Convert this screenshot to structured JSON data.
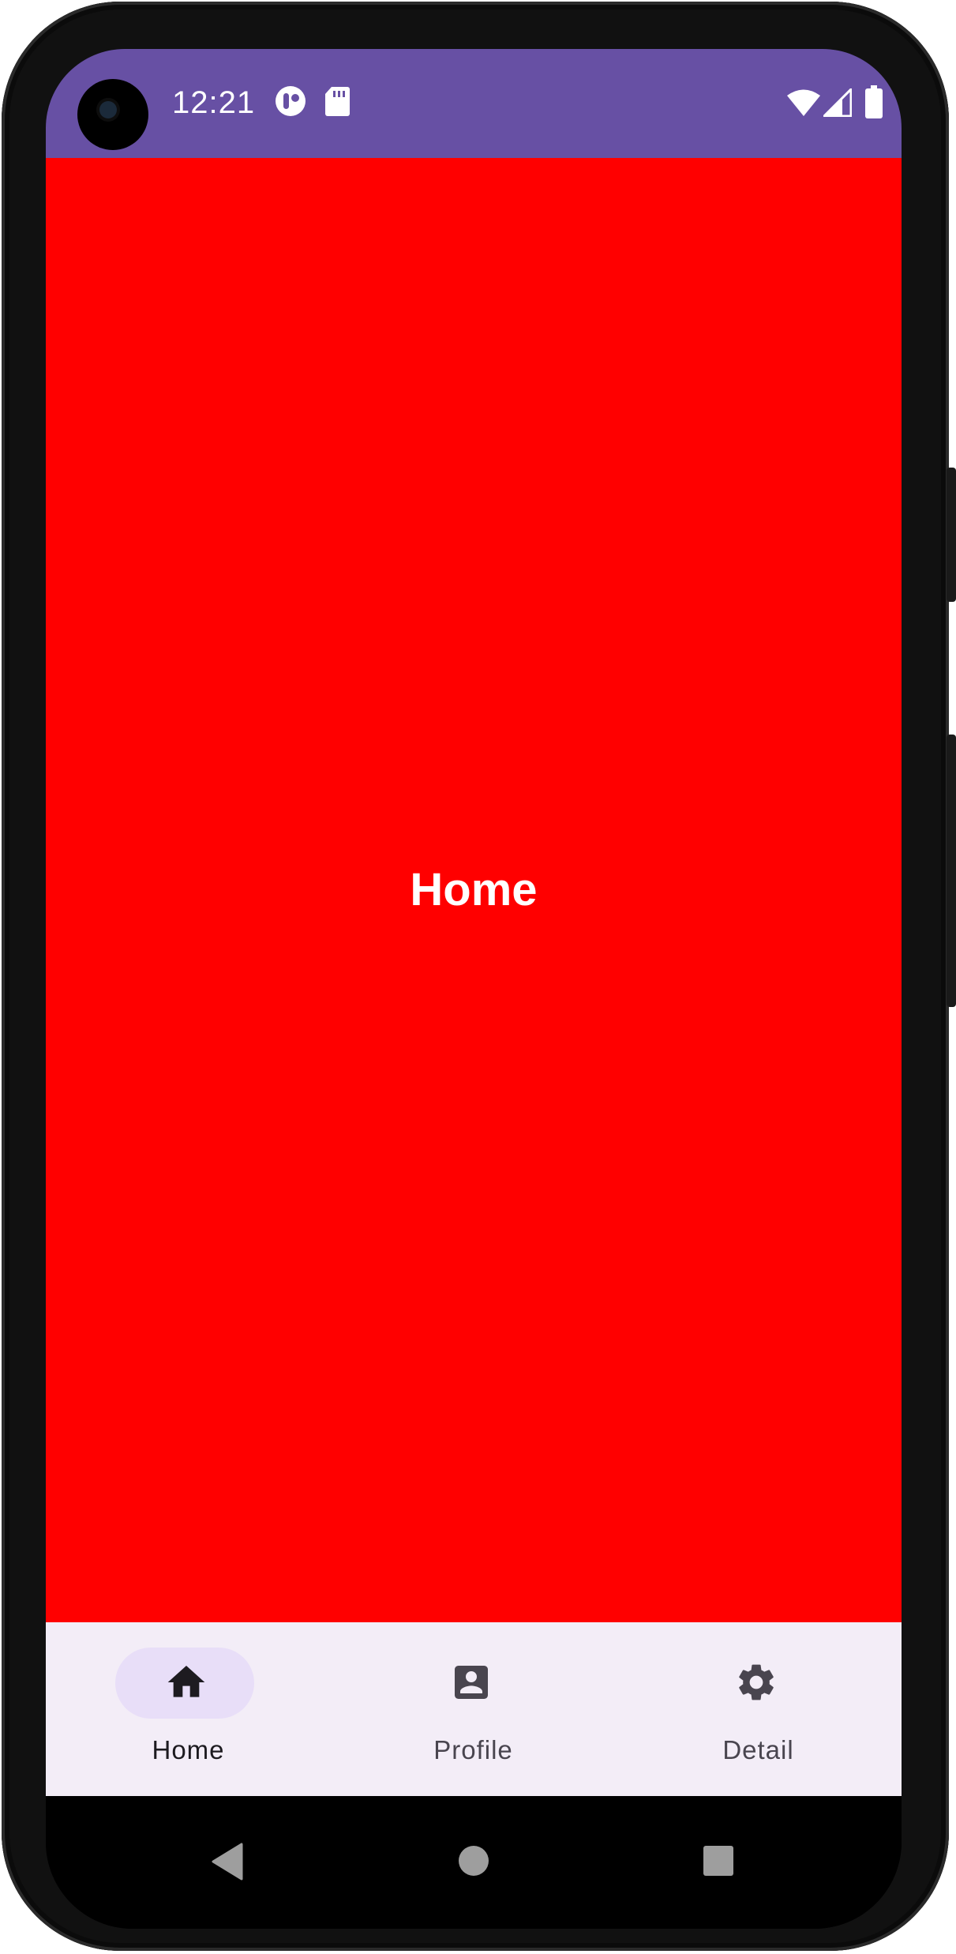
{
  "status_bar": {
    "time": "12:21",
    "background": "#6750a4",
    "icons": [
      "app-notification-icon",
      "sd-card-icon",
      "wifi-icon",
      "cellular-signal-icon",
      "battery-icon"
    ]
  },
  "screen": {
    "title": "Home",
    "background": "#ff0000"
  },
  "bottom_nav": {
    "background": "#f3edf7",
    "selected": "Home",
    "items": [
      {
        "label": "Home",
        "icon": "home-icon",
        "selected": true
      },
      {
        "label": "Profile",
        "icon": "account-box-icon",
        "selected": false
      },
      {
        "label": "Detail",
        "icon": "settings-gear-icon",
        "selected": false
      }
    ]
  },
  "system_nav": {
    "buttons": [
      "back-icon",
      "home-circle-icon",
      "recents-square-icon"
    ]
  }
}
